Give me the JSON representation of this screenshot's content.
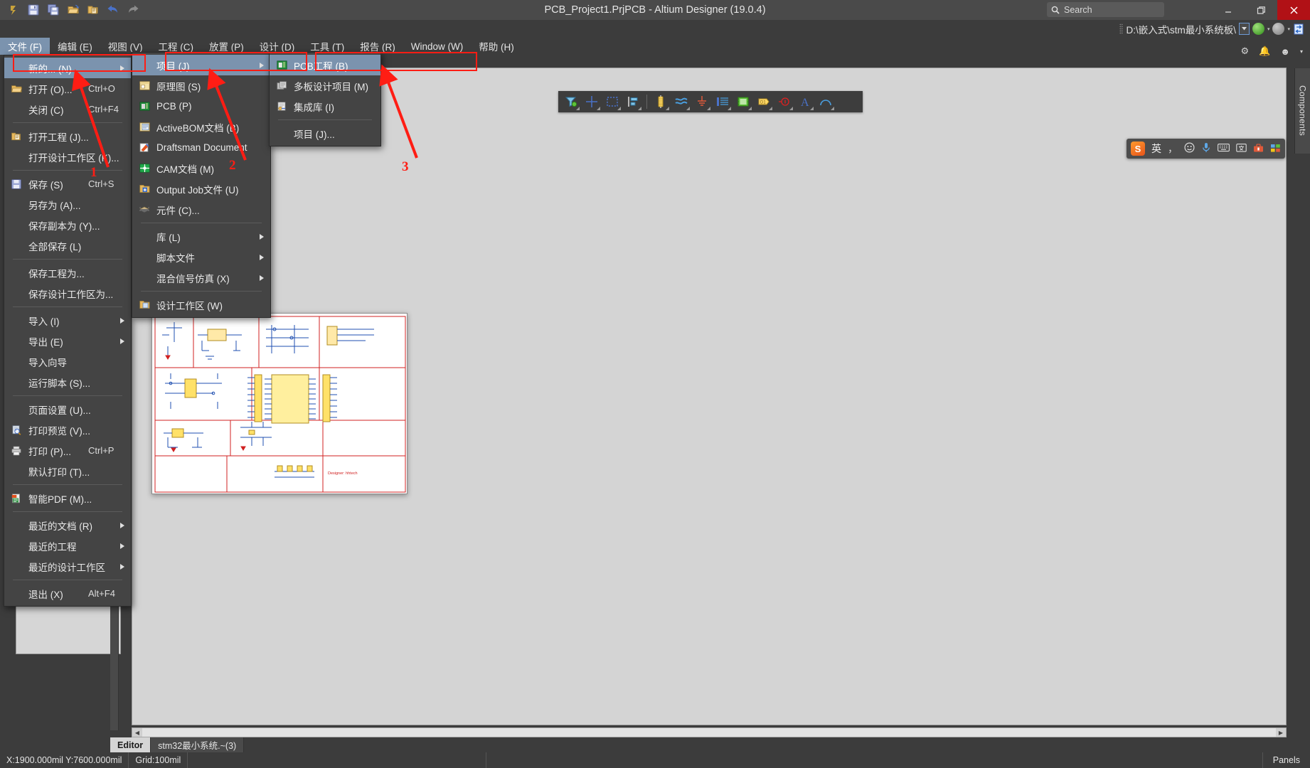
{
  "window": {
    "title": "PCB_Project1.PrjPCB - Altium Designer (19.0.4)",
    "search_placeholder": "Search",
    "minimize": "_",
    "restore": "❐",
    "close": "✕"
  },
  "quick_access": [
    {
      "name": "altium-logo-icon",
      "glyph": "Ꭾ"
    },
    {
      "name": "save-icon",
      "glyph": "▤"
    },
    {
      "name": "save-all-icon",
      "glyph": "▤"
    },
    {
      "name": "open-icon",
      "glyph": "📂"
    },
    {
      "name": "open-project-icon",
      "glyph": "📁"
    },
    {
      "name": "undo-icon",
      "glyph": "↩"
    },
    {
      "name": "redo-icon",
      "glyph": "↪"
    }
  ],
  "pathbar": {
    "path": "D:\\嵌入式\\stm最小系统板\\",
    "dropdown": "▼",
    "back_label": "◀",
    "forward_label": "▶",
    "refresh_label": "⇄"
  },
  "system_icons": [
    {
      "name": "settings-gear-icon",
      "glyph": "⚙"
    },
    {
      "name": "notifications-bell-icon",
      "glyph": "🔔"
    },
    {
      "name": "account-icon",
      "glyph": "☻"
    },
    {
      "name": "account-caret-icon",
      "glyph": "▾"
    }
  ],
  "menubar": [
    {
      "label": "文件 (F)",
      "active": true
    },
    {
      "label": "编辑 (E)",
      "active": false
    },
    {
      "label": "视图 (V)",
      "active": false
    },
    {
      "label": "工程 (C)",
      "active": false
    },
    {
      "label": "放置 (P)",
      "active": false
    },
    {
      "label": "设计 (D)",
      "active": false
    },
    {
      "label": "工具 (T)",
      "active": false
    },
    {
      "label": "报告 (R)",
      "active": false
    },
    {
      "label": "Window (W)",
      "active": false
    },
    {
      "label": "帮助 (H)",
      "active": false
    }
  ],
  "file_menu": [
    {
      "label": "新的... (N)",
      "shortcut": "",
      "submenu": true,
      "selected": true,
      "icon": ""
    },
    {
      "label": "打开 (O)...",
      "shortcut": "Ctrl+O",
      "icon": "open-folder-icon"
    },
    {
      "label": "关闭 (C)",
      "shortcut": "Ctrl+F4",
      "icon": ""
    },
    {
      "sep": true
    },
    {
      "label": "打开工程 (J)...",
      "shortcut": "",
      "icon": "open-project-icon"
    },
    {
      "label": "打开设计工作区 (K)...",
      "shortcut": "",
      "icon": ""
    },
    {
      "sep": true
    },
    {
      "label": "保存 (S)",
      "shortcut": "Ctrl+S",
      "icon": "save-icon"
    },
    {
      "label": "另存为 (A)...",
      "shortcut": "",
      "icon": ""
    },
    {
      "label": "保存副本为 (Y)...",
      "shortcut": "",
      "icon": ""
    },
    {
      "label": "全部保存 (L)",
      "shortcut": "",
      "icon": ""
    },
    {
      "sep": true
    },
    {
      "label": "保存工程为...",
      "shortcut": "",
      "icon": ""
    },
    {
      "label": "保存设计工作区为...",
      "shortcut": "",
      "icon": ""
    },
    {
      "sep": true
    },
    {
      "label": "导入 (I)",
      "shortcut": "",
      "submenu": true,
      "icon": ""
    },
    {
      "label": "导出 (E)",
      "shortcut": "",
      "submenu": true,
      "icon": ""
    },
    {
      "label": "导入向导",
      "shortcut": "",
      "icon": ""
    },
    {
      "label": "运行脚本 (S)...",
      "shortcut": "",
      "icon": ""
    },
    {
      "sep": true
    },
    {
      "label": "页面设置 (U)...",
      "shortcut": "",
      "icon": ""
    },
    {
      "label": "打印预览 (V)...",
      "shortcut": "",
      "icon": "print-preview-icon"
    },
    {
      "label": "打印 (P)...",
      "shortcut": "Ctrl+P",
      "icon": "printer-icon"
    },
    {
      "label": "默认打印 (T)...",
      "shortcut": "",
      "icon": ""
    },
    {
      "sep": true
    },
    {
      "label": "智能PDF (M)...",
      "shortcut": "",
      "icon": "pdf-icon"
    },
    {
      "sep": true
    },
    {
      "label": "最近的文档 (R)",
      "shortcut": "",
      "submenu": true,
      "icon": ""
    },
    {
      "label": "最近的工程",
      "shortcut": "",
      "submenu": true,
      "icon": ""
    },
    {
      "label": "最近的设计工作区",
      "shortcut": "",
      "submenu": true,
      "icon": ""
    },
    {
      "sep": true
    },
    {
      "label": "退出 (X)",
      "shortcut": "Alt+F4",
      "icon": ""
    }
  ],
  "new_menu": [
    {
      "label": "项目 (J)",
      "submenu": true,
      "selected": true,
      "icon": ""
    },
    {
      "label": "原理图 (S)",
      "icon": "schematic-icon"
    },
    {
      "label": "PCB (P)",
      "icon": "pcb-icon"
    },
    {
      "label": "ActiveBOM文档 (B)",
      "icon": "bom-icon"
    },
    {
      "label": "Draftsman Document",
      "icon": "draftsman-icon"
    },
    {
      "label": "CAM文档 (M)",
      "icon": "cam-icon"
    },
    {
      "label": "Output Job文件 (U)",
      "icon": "outputjob-icon"
    },
    {
      "label": "元件 (C)...",
      "icon": "component-icon"
    },
    {
      "sep": true
    },
    {
      "label": "库 (L)",
      "submenu": true,
      "icon": ""
    },
    {
      "label": "脚本文件",
      "submenu": true,
      "icon": ""
    },
    {
      "label": "混合信号仿真 (X)",
      "submenu": true,
      "icon": ""
    },
    {
      "sep": true
    },
    {
      "label": "设计工作区 (W)",
      "icon": "workspace-icon"
    }
  ],
  "project_menu": [
    {
      "label": "PCB工程 (B)",
      "selected": true,
      "icon": "pcb-project-icon"
    },
    {
      "label": "多板设计项目 (M)",
      "icon": "multiboard-icon"
    },
    {
      "label": "集成库 (I)",
      "icon": "integrated-lib-icon"
    },
    {
      "sep": true
    },
    {
      "label": "项目 (J)...",
      "icon": ""
    }
  ],
  "annotations": [
    {
      "number": "1"
    },
    {
      "number": "2"
    },
    {
      "number": "3"
    }
  ],
  "placement_toolbar": [
    {
      "name": "net-label-filter-icon"
    },
    {
      "name": "crosshair-place-icon"
    },
    {
      "name": "rectangle-select-icon"
    },
    {
      "name": "align-icon"
    },
    {
      "sep": true
    },
    {
      "name": "resistor-place-icon"
    },
    {
      "name": "wire-place-icon"
    },
    {
      "name": "gnd-power-port-icon"
    },
    {
      "name": "bus-place-icon"
    },
    {
      "name": "sheet-symbol-icon"
    },
    {
      "name": "port-place-icon"
    },
    {
      "name": "no-erc-icon"
    },
    {
      "name": "text-string-icon"
    },
    {
      "name": "arc-place-icon"
    }
  ],
  "ime_bar": {
    "logo": "S",
    "mode": "英",
    "items": [
      {
        "name": "ime-mode-label",
        "glyph": "英"
      },
      {
        "name": "ime-punctuation-icon",
        "glyph": "，"
      },
      {
        "name": "ime-emoji-icon",
        "glyph": "☺"
      },
      {
        "name": "ime-voice-icon",
        "glyph": "🎤"
      },
      {
        "name": "ime-keyboard-icon",
        "glyph": "⌨"
      },
      {
        "name": "ime-translate-icon",
        "glyph": "囧"
      },
      {
        "name": "ime-toolbox-icon",
        "glyph": "🧰"
      },
      {
        "name": "ime-apps-icon",
        "glyph": "▦"
      }
    ]
  },
  "right_panel": {
    "components_label": "Components"
  },
  "schematic_preview": {
    "designer_note": "Designer: hhtech"
  },
  "doc_tabs": [
    {
      "label": "Editor",
      "active": true
    },
    {
      "label": "stm32最小系统.~(3)",
      "active": false
    }
  ],
  "statusbar": {
    "coords": "X:1900.000mil Y:7600.000mil",
    "grid": "Grid:100mil",
    "panels": "Panels"
  },
  "colors": {
    "accent_selection": "#7b93ae",
    "annotation_red": "#ff1d14",
    "title_bg": "#4a4a4a",
    "menu_bg": "#444444",
    "close_red": "#b11116",
    "canvas": "#d4d4d4"
  }
}
